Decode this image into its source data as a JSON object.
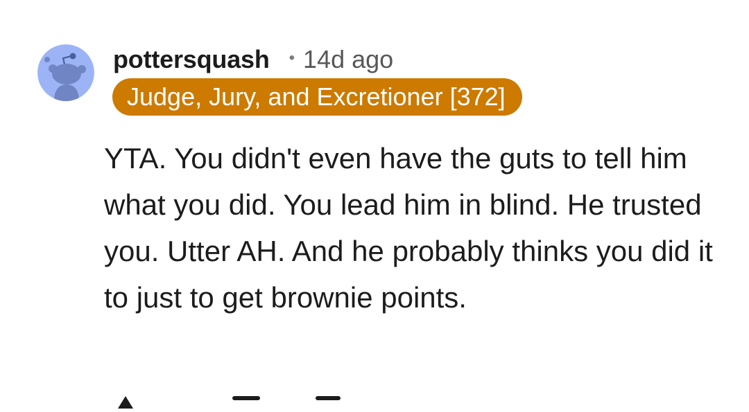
{
  "comment": {
    "author": "pottersquash",
    "separator": "•",
    "age": "14d ago",
    "flair": {
      "text": "Judge, Jury, and Excretioner [372]",
      "background": "#cc7a00",
      "color": "#ffffff"
    },
    "body": "YTA. You didn't even have the guts to tell him what you did. You lead him in blind. He trusted you. Utter AH. And he probably thinks you did it to just to get brownie points."
  },
  "avatar": {
    "icon": "snoo-avatar-icon",
    "background": "#9cb4f6"
  },
  "actions": {
    "icons": [
      "award-icon",
      "reply-icon",
      "more-icon"
    ]
  }
}
